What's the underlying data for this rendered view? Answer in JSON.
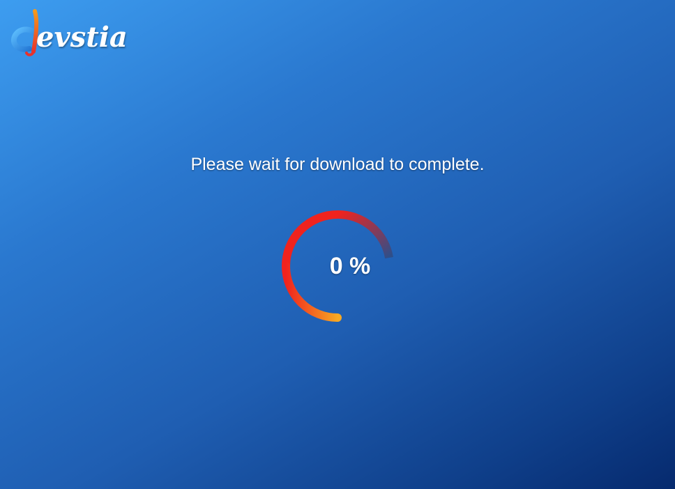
{
  "brand": {
    "name": "evstia",
    "mark_letter": "d",
    "colors": {
      "mark_blue": "#3aa6f5",
      "mark_red": "#e8322c",
      "mark_orange": "#f59a1b"
    }
  },
  "download": {
    "message": "Please wait for download to complete.",
    "percent_label": "0 %",
    "progress": 0,
    "spinner_colors": {
      "red": "#f0231e",
      "orange": "#f7a823",
      "fade": "#2d4f8a"
    }
  }
}
